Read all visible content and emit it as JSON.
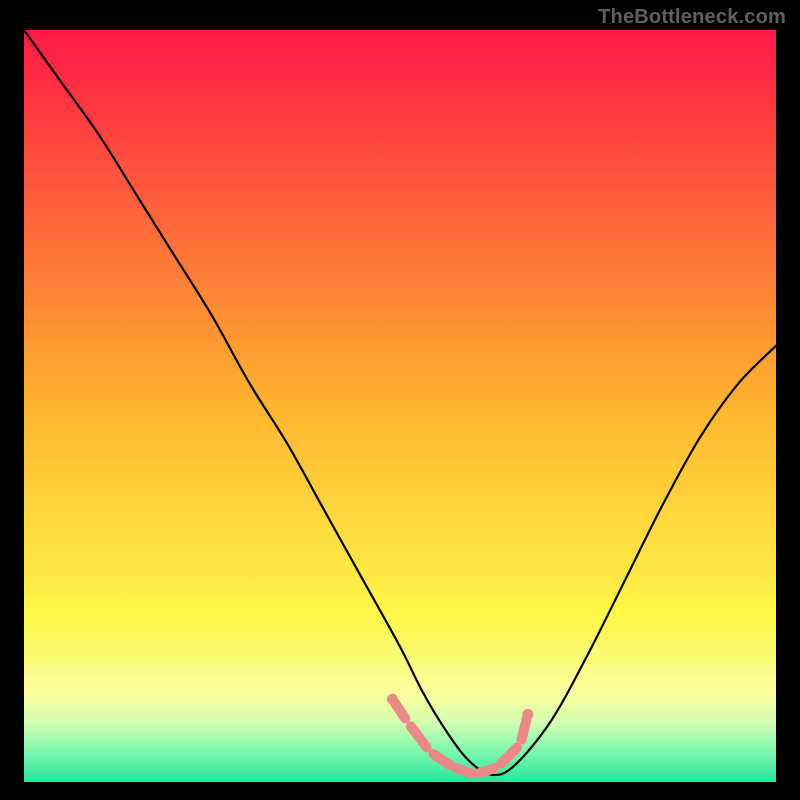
{
  "attribution": {
    "watermark": "TheBottleneck.com"
  },
  "chart_data": {
    "type": "line",
    "title": "",
    "xlabel": "",
    "ylabel": "",
    "x_range": [
      0,
      100
    ],
    "y_range": [
      0,
      100
    ],
    "axes_visible": false,
    "grid": false,
    "legend": false,
    "background": {
      "type": "vertical-gradient",
      "stops": [
        {
          "pos": 0.0,
          "color": "#ff1846"
        },
        {
          "pos": 0.5,
          "color": "#ffb430"
        },
        {
          "pos": 0.78,
          "color": "#fff74a"
        },
        {
          "pos": 0.88,
          "color": "#fbff9d"
        },
        {
          "pos": 0.92,
          "color": "#d6ffb2"
        },
        {
          "pos": 0.96,
          "color": "#7cf7ad"
        },
        {
          "pos": 1.0,
          "color": "#24e69c"
        }
      ]
    },
    "series": [
      {
        "name": "bottleneck-curve",
        "color": "#000000",
        "x": [
          0,
          5,
          10,
          15,
          20,
          25,
          30,
          35,
          40,
          45,
          50,
          53,
          56,
          59,
          62,
          65,
          70,
          75,
          80,
          85,
          90,
          95,
          100
        ],
        "y": [
          100,
          93,
          86,
          78,
          70,
          62,
          53,
          45,
          36,
          27,
          18,
          12,
          7,
          3,
          1,
          2,
          8,
          17,
          27,
          37,
          46,
          53,
          58
        ]
      }
    ],
    "highlight": {
      "name": "optimal-region",
      "color": "#e98a88",
      "points": [
        {
          "x": 49,
          "y": 11
        },
        {
          "x": 51,
          "y": 8
        },
        {
          "x": 54,
          "y": 4
        },
        {
          "x": 57,
          "y": 2
        },
        {
          "x": 60,
          "y": 1
        },
        {
          "x": 63,
          "y": 2
        },
        {
          "x": 66,
          "y": 5
        },
        {
          "x": 67,
          "y": 9
        }
      ]
    }
  }
}
